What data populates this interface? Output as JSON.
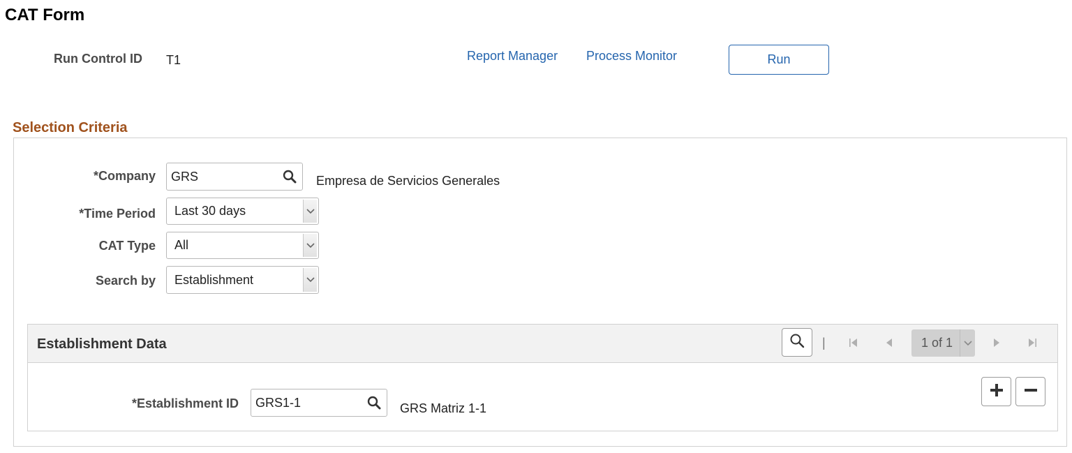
{
  "page": {
    "title": "CAT Form"
  },
  "run_control": {
    "label": "Run Control ID",
    "value": "T1",
    "report_manager": "Report Manager",
    "process_monitor": "Process Monitor",
    "run_button": "Run"
  },
  "selection": {
    "title": "Selection Criteria",
    "company": {
      "label": "*Company",
      "value": "GRS",
      "description": "Empresa de Servicios Generales",
      "icon": "search-icon"
    },
    "time_period": {
      "label": "*Time Period",
      "value": "Last 30 days"
    },
    "cat_type": {
      "label": "CAT Type",
      "value": "All"
    },
    "search_by": {
      "label": "Search by",
      "value": "Establishment"
    }
  },
  "establishment_grid": {
    "title": "Establishment Data",
    "pager_text": "1 of 1",
    "separator": "|",
    "establishment_id": {
      "label": "*Establishment ID",
      "value": "GRS1-1",
      "description": "GRS Matriz 1-1",
      "icon": "search-icon"
    },
    "add_icon": "plus-icon",
    "delete_icon": "minus-icon"
  },
  "colors": {
    "link": "#2565ae",
    "section_title": "#a0521d",
    "grid_header_bg": "#f2f2f2",
    "border": "#d1d1d1"
  }
}
